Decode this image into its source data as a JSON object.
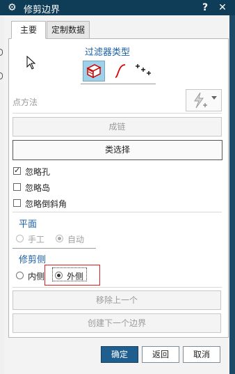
{
  "window": {
    "title": "修剪边界",
    "help_label": "?",
    "close_label": "✕"
  },
  "tabs": [
    {
      "label": "主要",
      "active": true
    },
    {
      "label": "定制数据",
      "active": false
    }
  ],
  "filter": {
    "title": "过滤器类型"
  },
  "point_method": {
    "label": "点方法"
  },
  "buttons": {
    "chain": "成链",
    "class_select": "类选择",
    "remove_previous": "移除上一个",
    "create_next_boundary": "创建下一个边界"
  },
  "checkboxes": [
    {
      "label": "忽略孔",
      "checked": true
    },
    {
      "label": "忽略岛",
      "checked": false
    },
    {
      "label": "忽略倒斜角",
      "checked": false
    }
  ],
  "plane": {
    "title": "平面",
    "options": [
      {
        "label": "手工",
        "selected": false
      },
      {
        "label": "自动",
        "selected": true
      }
    ]
  },
  "trim_side": {
    "title": "修剪侧",
    "options": [
      {
        "label": "内侧",
        "selected": false
      },
      {
        "label": "外侧",
        "selected": true
      }
    ]
  },
  "footer": {
    "ok": "确定",
    "back": "返回",
    "cancel": "取消"
  },
  "colors": {
    "titlebar": "#0f3c57",
    "accent_blue": "#1b5fa7",
    "primary_button": "#1f5f8f",
    "highlight_red": "#e02020"
  }
}
